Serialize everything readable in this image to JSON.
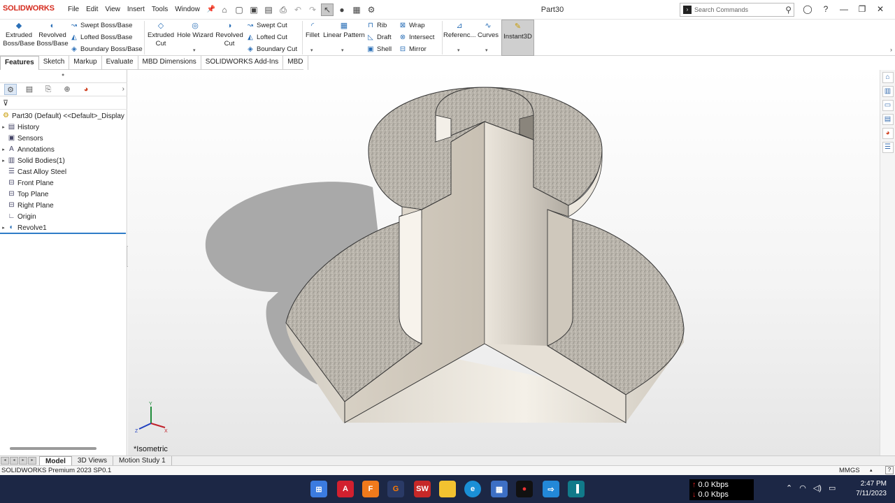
{
  "app": {
    "logo_text": "SOLIDWORKS",
    "title": "Part30",
    "search_placeholder": "Search Commands"
  },
  "menu": [
    "File",
    "Edit",
    "View",
    "Insert",
    "Tools",
    "Window"
  ],
  "ribbon": {
    "extruded_boss": "Extruded Boss/Base",
    "revolved_boss": "Revolved Boss/Base",
    "swept_boss": "Swept Boss/Base",
    "lofted_boss": "Lofted Boss/Base",
    "boundary_boss": "Boundary Boss/Base",
    "extruded_cut": "Extruded Cut",
    "hole_wizard": "Hole Wizard",
    "revolved_cut": "Revolved Cut",
    "swept_cut": "Swept Cut",
    "lofted_cut": "Lofted Cut",
    "boundary_cut": "Boundary Cut",
    "fillet": "Fillet",
    "linear_pattern": "Linear Pattern",
    "rib": "Rib",
    "draft": "Draft",
    "shell": "Shell",
    "wrap": "Wrap",
    "intersect": "Intersect",
    "mirror": "Mirror",
    "reference": "Referenc...",
    "curves": "Curves",
    "instant3d": "Instant3D"
  },
  "tabs": [
    "Features",
    "Sketch",
    "Markup",
    "Evaluate",
    "MBD Dimensions",
    "SOLIDWORKS Add-Ins",
    "MBD"
  ],
  "tree": {
    "root": "Part30 (Default) <<Default>_Display",
    "items": [
      "History",
      "Sensors",
      "Annotations",
      "Solid Bodies(1)",
      "Cast Alloy Steel",
      "Front Plane",
      "Top Plane",
      "Right Plane",
      "Origin",
      "Revolve1"
    ]
  },
  "viewport": {
    "view_name": "*Isometric"
  },
  "bottom_tabs": [
    "Model",
    "3D Views",
    "Motion Study 1"
  ],
  "status": {
    "left": "SOLIDWORKS Premium 2023 SP0.1",
    "units": "MMGS"
  },
  "taskbar": {
    "net_up": "0.0 Kbps",
    "net_down": "0.0 Kbps",
    "time": "2:47 PM",
    "date": "7/11/2023"
  },
  "colors": {
    "accent": "#2a6fb7",
    "brand": "#d52b1e",
    "taskbar": "#1c2745",
    "selection": "#2f7cc7"
  }
}
